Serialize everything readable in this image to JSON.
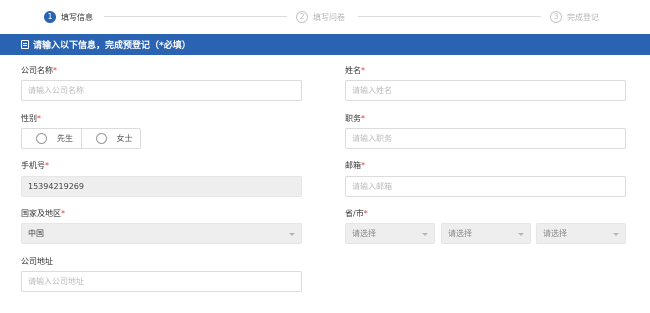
{
  "stepper": {
    "steps": [
      {
        "num": "1",
        "label": "填写信息"
      },
      {
        "num": "2",
        "label": "填写问卷"
      },
      {
        "num": "3",
        "label": "完成登记"
      }
    ]
  },
  "header": {
    "title": "请输入以下信息，完成预登记（*必填）"
  },
  "form": {
    "company_name": {
      "label": "公司名称",
      "required": "*",
      "placeholder": "请输入公司名称"
    },
    "name": {
      "label": "姓名",
      "required": "*",
      "placeholder": "请输入姓名"
    },
    "gender": {
      "label": "性别",
      "required": "*",
      "options": [
        "先生",
        "女士"
      ]
    },
    "position": {
      "label": "职务",
      "required": "*",
      "placeholder": "请输入职务"
    },
    "phone": {
      "label": "手机号",
      "required": "*",
      "value": "15394219269"
    },
    "email": {
      "label": "邮箱",
      "required": "*",
      "placeholder": "请输入邮箱"
    },
    "country": {
      "label": "国家及地区",
      "required": "*",
      "value": "中国"
    },
    "province_city": {
      "label": "省/市",
      "required": "*",
      "selects": [
        "请选择",
        "请选择",
        "请选择"
      ]
    },
    "address": {
      "label": "公司地址",
      "placeholder": "请输入公司地址"
    }
  },
  "colors": {
    "brand": "#2a63b1",
    "required": "#e4393c"
  }
}
